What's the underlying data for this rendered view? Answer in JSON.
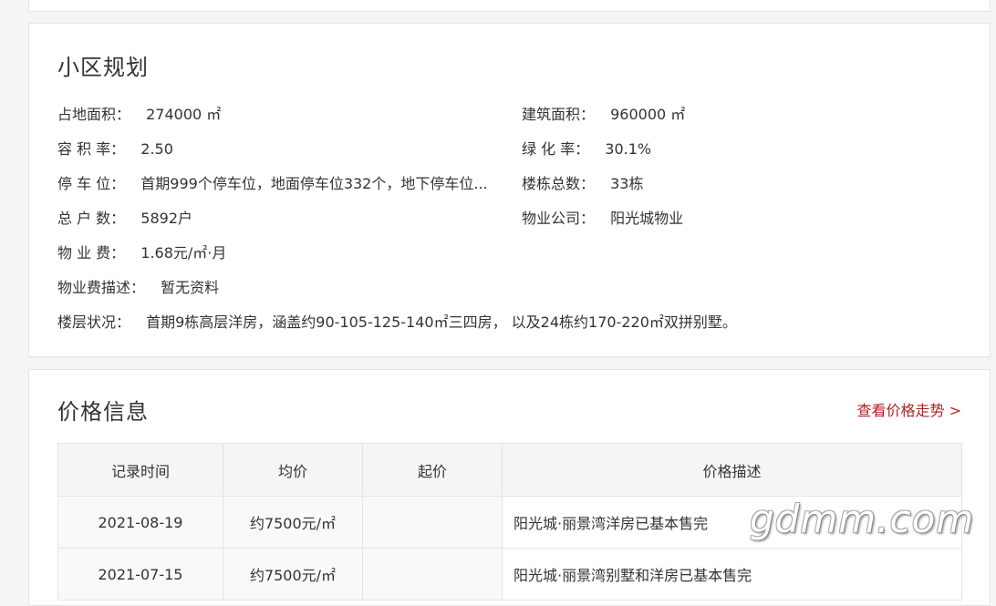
{
  "plan": {
    "title": "小区规划",
    "left": [
      {
        "label": "占地面积：",
        "value": "274000 ㎡"
      },
      {
        "label": "容 积 率：",
        "value": "2.50"
      },
      {
        "label": "停 车 位：",
        "value": "首期999个停车位，地面停车位332个，地下停车位..."
      },
      {
        "label": "总 户 数：",
        "value": "5892户"
      },
      {
        "label": "物 业 费：",
        "value": "1.68元/㎡·月"
      },
      {
        "label": "物业费描述：",
        "value": "暂无资料"
      },
      {
        "label": "楼层状况：",
        "value": "首期9栋高层洋房，涵盖约90-105-125-140㎡三四房， 以及24栋约170-220㎡双拼别墅。"
      }
    ],
    "right": [
      {
        "label": "建筑面积：",
        "value": "960000 ㎡"
      },
      {
        "label": "绿 化 率：",
        "value": "30.1%"
      },
      {
        "label": "楼栋总数：",
        "value": "33栋"
      },
      {
        "label": "物业公司：",
        "value": "阳光城物业"
      }
    ]
  },
  "price": {
    "title": "价格信息",
    "trend_link": "查看价格走势 >",
    "headers": [
      "记录时间",
      "均价",
      "起价",
      "价格描述"
    ],
    "rows": [
      {
        "date": "2021-08-19",
        "avg": "约7500元/㎡",
        "start": "",
        "desc": "阳光城·丽景湾洋房已基本售完"
      },
      {
        "date": "2021-07-15",
        "avg": "约7500元/㎡",
        "start": "",
        "desc": "阳光城·丽景湾别墅和洋房已基本售完"
      }
    ]
  },
  "watermark": "gdmm.com"
}
